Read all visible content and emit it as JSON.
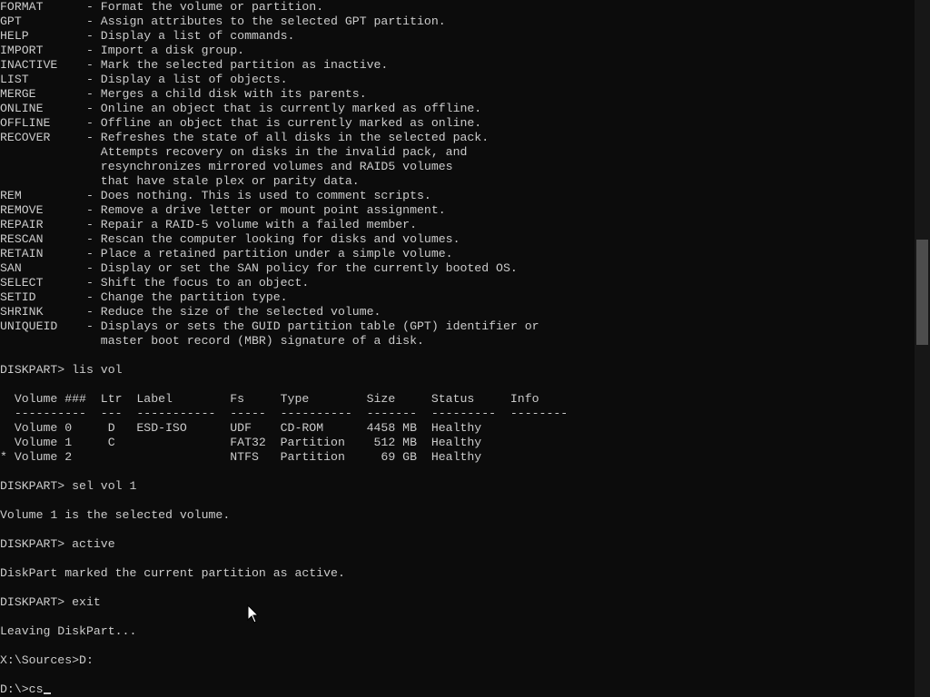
{
  "console": {
    "lines": [
      "FORMAT      - Format the volume or partition.",
      "GPT         - Assign attributes to the selected GPT partition.",
      "HELP        - Display a list of commands.",
      "IMPORT      - Import a disk group.",
      "INACTIVE    - Mark the selected partition as inactive.",
      "LIST        - Display a list of objects.",
      "MERGE       - Merges a child disk with its parents.",
      "ONLINE      - Online an object that is currently marked as offline.",
      "OFFLINE     - Offline an object that is currently marked as online.",
      "RECOVER     - Refreshes the state of all disks in the selected pack.",
      "              Attempts recovery on disks in the invalid pack, and",
      "              resynchronizes mirrored volumes and RAID5 volumes",
      "              that have stale plex or parity data.",
      "REM         - Does nothing. This is used to comment scripts.",
      "REMOVE      - Remove a drive letter or mount point assignment.",
      "REPAIR      - Repair a RAID-5 volume with a failed member.",
      "RESCAN      - Rescan the computer looking for disks and volumes.",
      "RETAIN      - Place a retained partition under a simple volume.",
      "SAN         - Display or set the SAN policy for the currently booted OS.",
      "SELECT      - Shift the focus to an object.",
      "SETID       - Change the partition type.",
      "SHRINK      - Reduce the size of the selected volume.",
      "UNIQUEID    - Displays or sets the GUID partition table (GPT) identifier or",
      "              master boot record (MBR) signature of a disk.",
      "",
      "DISKPART> lis vol",
      "",
      "  Volume ###  Ltr  Label        Fs     Type        Size     Status     Info",
      "  ----------  ---  -----------  -----  ----------  -------  ---------  --------",
      "  Volume 0     D   ESD-ISO      UDF    CD-ROM      4458 MB  Healthy",
      "  Volume 1     C                FAT32  Partition    512 MB  Healthy",
      "* Volume 2                      NTFS   Partition     69 GB  Healthy",
      "",
      "DISKPART> sel vol 1",
      "",
      "Volume 1 is the selected volume.",
      "",
      "DISKPART> active",
      "",
      "DiskPart marked the current partition as active.",
      "",
      "DISKPART> exit",
      "",
      "Leaving DiskPart...",
      "",
      "X:\\Sources>D:",
      ""
    ],
    "prompt": "D:\\>",
    "input_value": "cs"
  },
  "icons": {
    "mouse_cursor": "arrow-pointer-icon",
    "caret": "text-caret-icon"
  },
  "colors": {
    "background": "#0c0c0c",
    "foreground": "#cccccc",
    "scrollbar_track": "#171717",
    "scrollbar_thumb": "#4d4d4d"
  }
}
